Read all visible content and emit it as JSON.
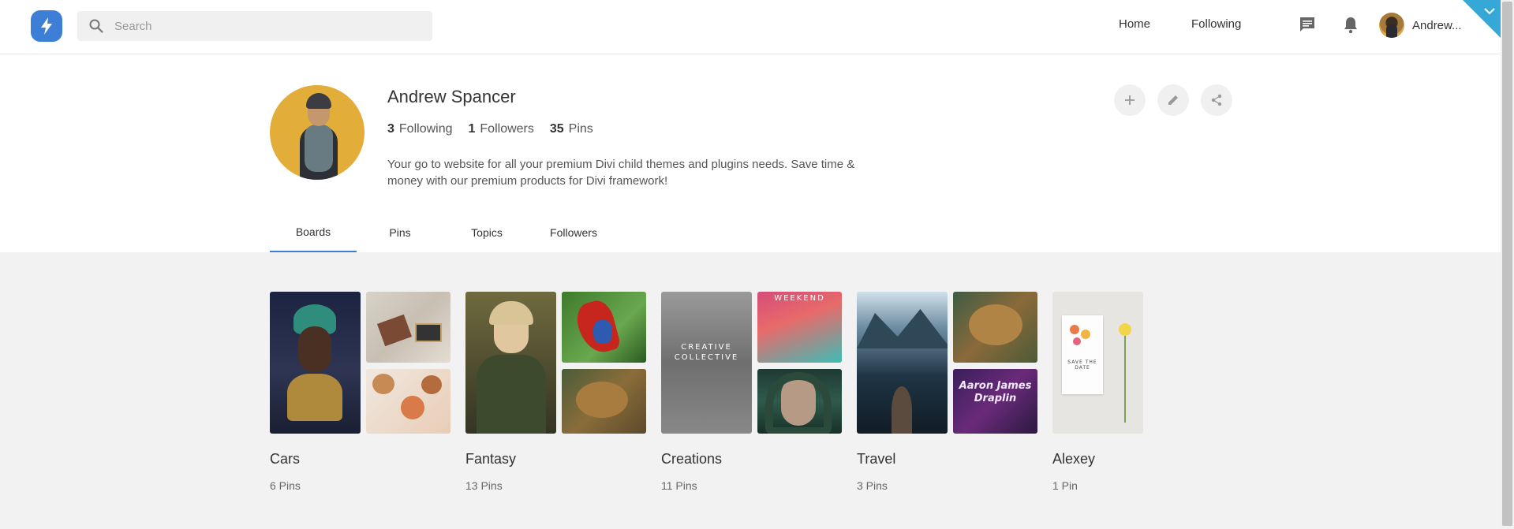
{
  "header": {
    "search_placeholder": "Search",
    "nav": {
      "home": "Home",
      "following": "Following"
    },
    "user_name": "Andrew...",
    "icons": [
      "bolt-logo-icon",
      "search-icon",
      "chat-icon",
      "bell-icon",
      "chevron-down-icon"
    ],
    "accent_color": "#3d7fd7",
    "ribbon_color": "#35a8d8"
  },
  "profile": {
    "name": "Andrew Spancer",
    "stats": [
      {
        "count": "3",
        "label": "Following"
      },
      {
        "count": "1",
        "label": "Followers"
      },
      {
        "count": "35",
        "label": "Pins"
      }
    ],
    "bio": "Your go to website for all your premium Divi child themes and plugins needs. Save time & money with our premium products for Divi framework!",
    "actions": [
      "add-icon",
      "edit-icon",
      "share-icon"
    ]
  },
  "tabs": [
    {
      "label": "Boards",
      "active": true
    },
    {
      "label": "Pins",
      "active": false
    },
    {
      "label": "Topics",
      "active": false
    },
    {
      "label": "Followers",
      "active": false
    }
  ],
  "boards": [
    {
      "title": "Cars",
      "count": "6 Pins"
    },
    {
      "title": "Fantasy",
      "count": "13 Pins"
    },
    {
      "title": "Creations",
      "count": "11 Pins",
      "thumb_text": {
        "weekend": "WEEKEND",
        "creative": "CREATIVE COLLECTIVE"
      }
    },
    {
      "title": "Travel",
      "count": "3 Pins",
      "thumb_text": {
        "poster": "Aaron James Draplin"
      }
    },
    {
      "title": "Alexey",
      "count": "1 Pin",
      "thumb_text": {
        "card": "SAVE THE DATE"
      }
    }
  ]
}
